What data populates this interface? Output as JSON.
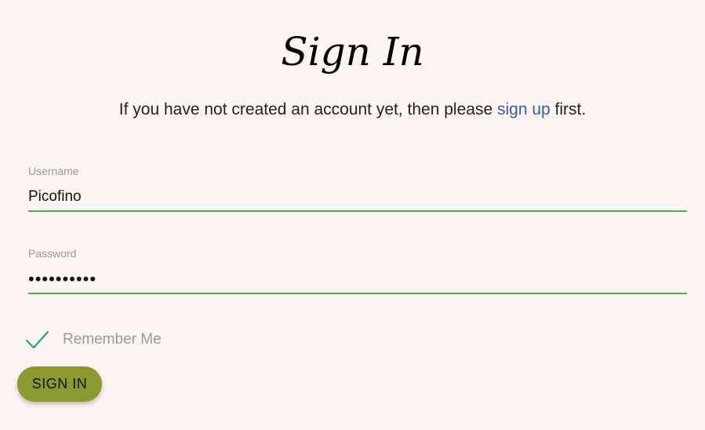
{
  "title": "Sign In",
  "intro": {
    "before": "If you have not created an account yet, then please ",
    "link": "sign up",
    "after": " first."
  },
  "username": {
    "label": "Username",
    "value": "Picofino"
  },
  "password": {
    "label": "Password",
    "value": "••••••••••"
  },
  "remember": {
    "label": "Remember Me",
    "checked": true
  },
  "submit": {
    "label": "SIGN IN"
  },
  "colors": {
    "background": "#fdf5f3",
    "link": "#2f5fa6",
    "field_underline": "#4caf50",
    "checkmark": "#2a9d8f",
    "button": "#8b9a2f"
  },
  "icons": {
    "remember": "checkmark-icon"
  }
}
